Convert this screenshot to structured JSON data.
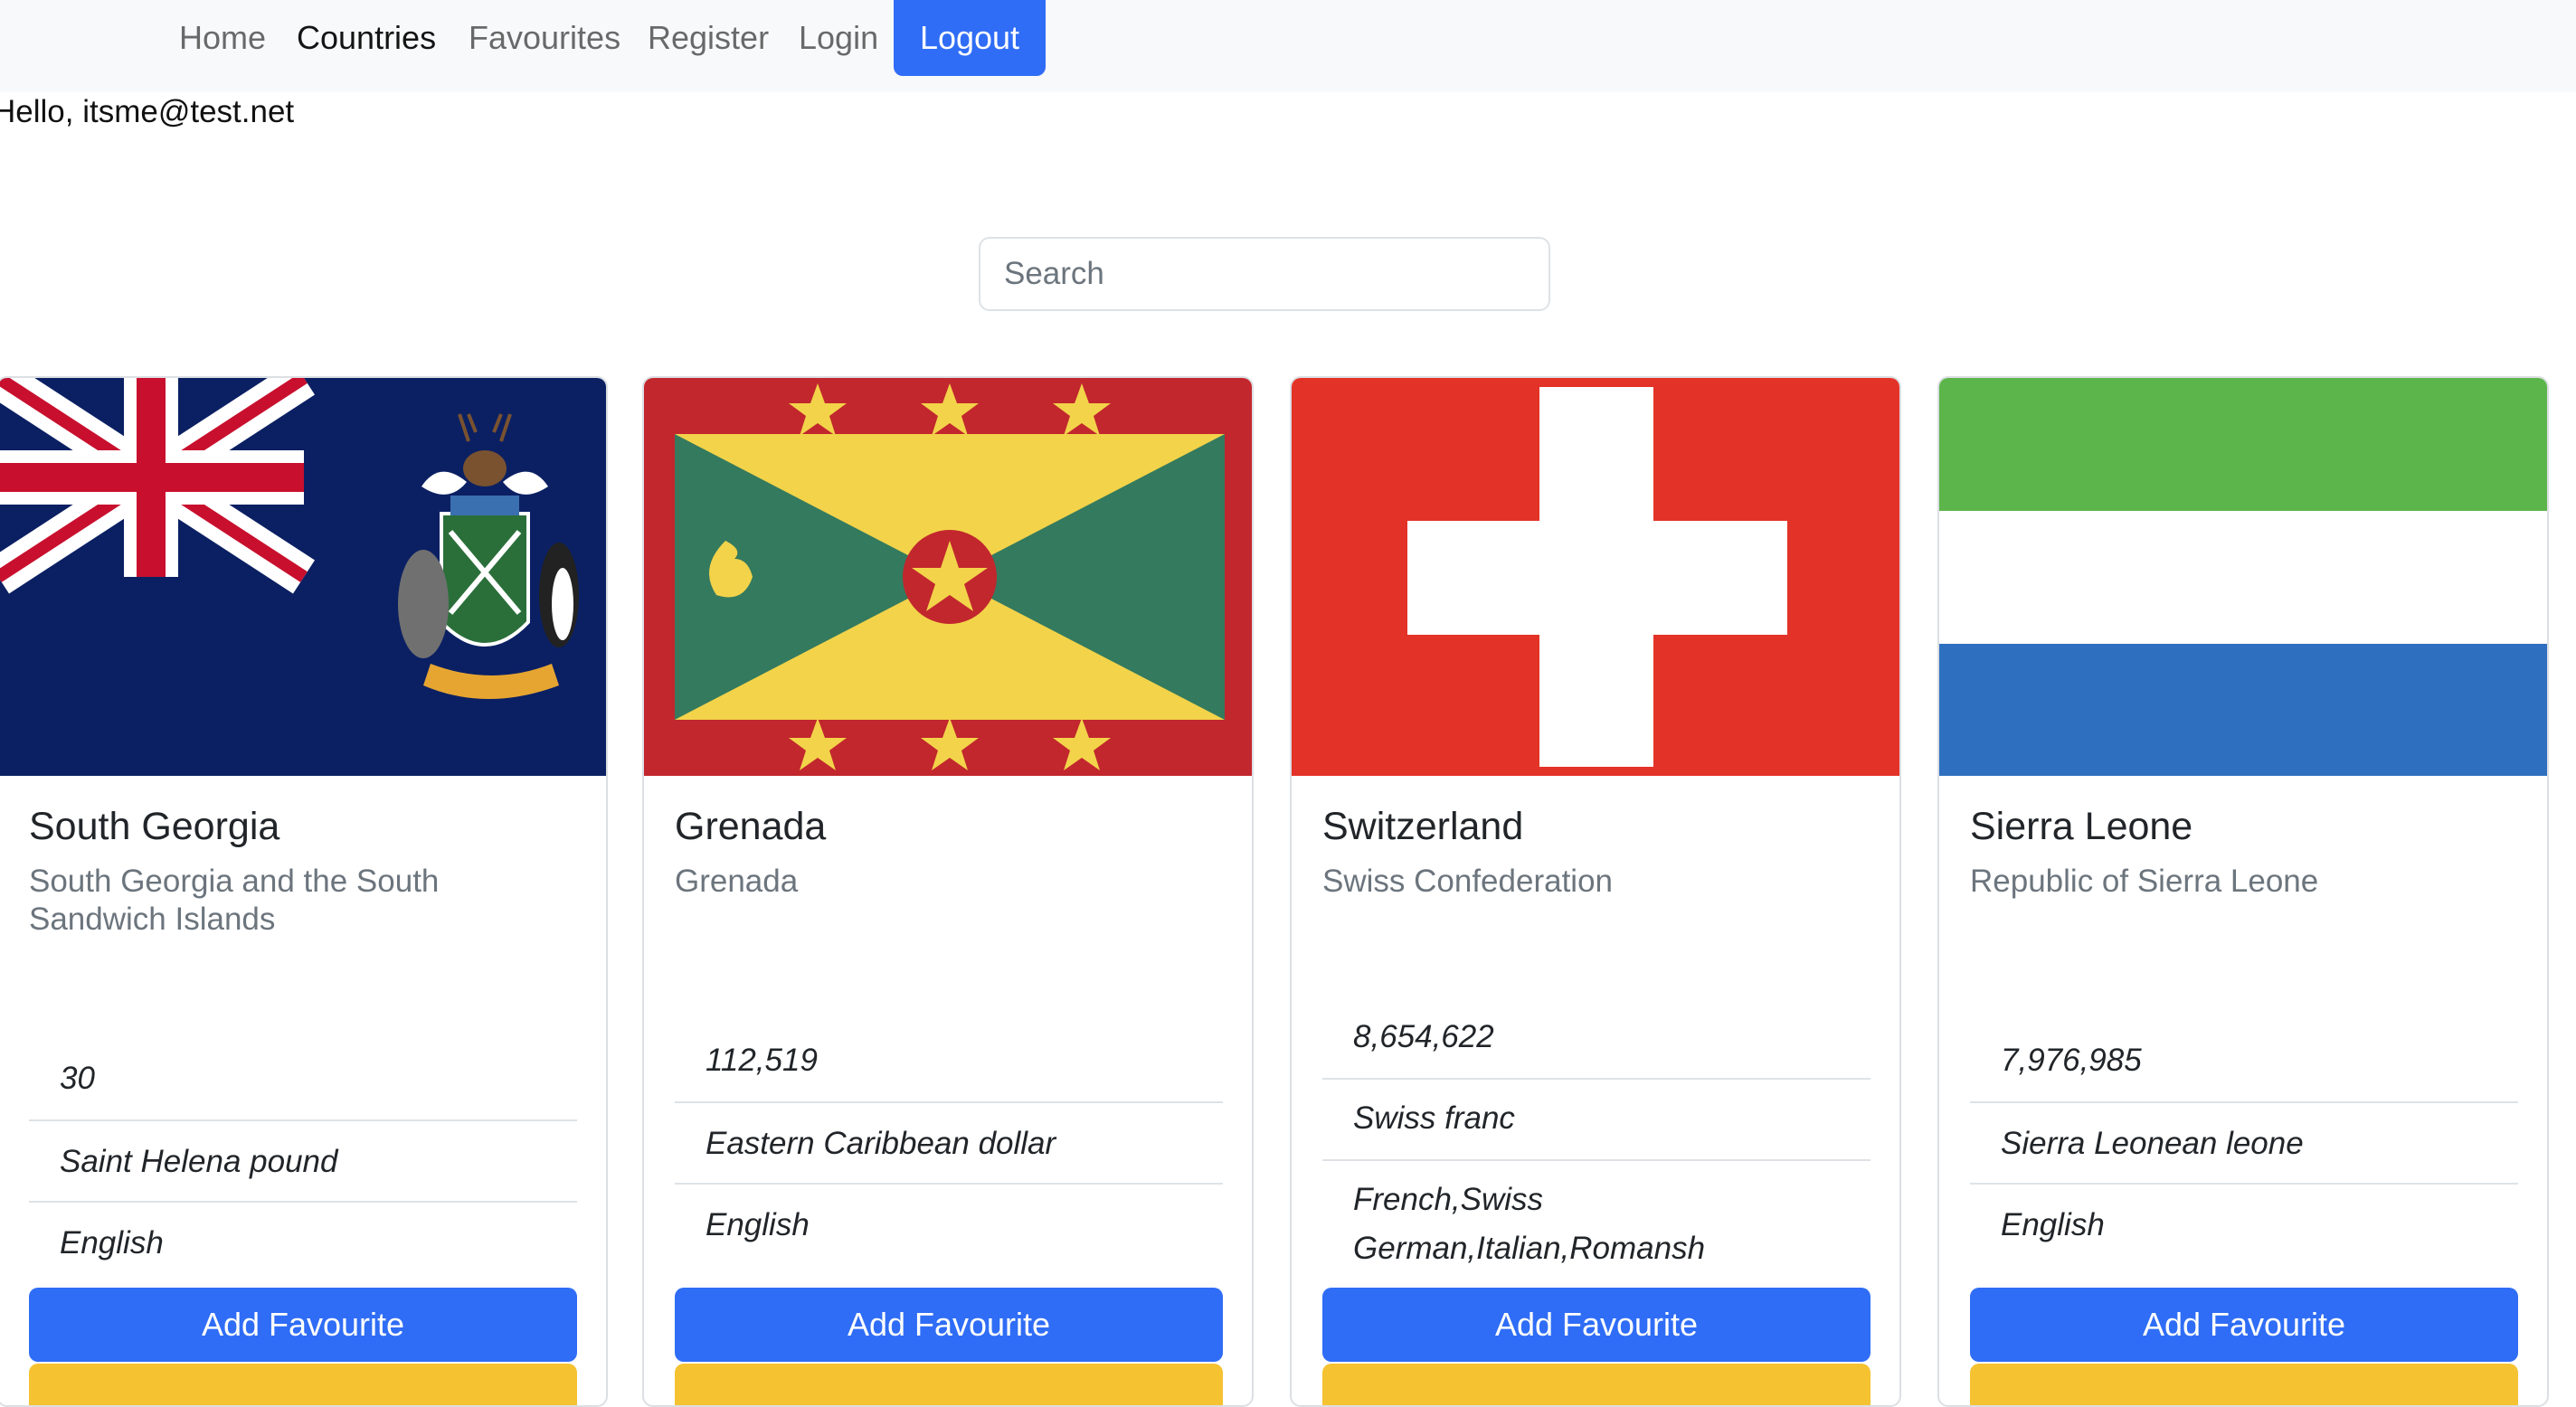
{
  "nav": {
    "home": "Home",
    "countries": "Countries",
    "favourites": "Favourites",
    "register": "Register",
    "login": "Login",
    "logout": "Logout"
  },
  "greeting": "Hello, itsme@test.net",
  "search": {
    "placeholder": "Search",
    "value": ""
  },
  "colors": {
    "primary": "#2f6df6",
    "warning": "#f5c232",
    "navbar_bg": "#f8f9fa"
  },
  "cards": [
    {
      "name": "South Georgia",
      "official_name": "South Georgia and the South Sandwich Islands",
      "population": "30",
      "currency": "Saint Helena pound",
      "languages": "English",
      "flag_icon": "south-georgia-flag-icon",
      "button_label": "Add Favourite"
    },
    {
      "name": "Grenada",
      "official_name": "Grenada",
      "population": "112,519",
      "currency": "Eastern Caribbean dollar",
      "languages": "English",
      "flag_icon": "grenada-flag-icon",
      "button_label": "Add Favourite"
    },
    {
      "name": "Switzerland",
      "official_name": "Swiss Confederation",
      "population": "8,654,622",
      "currency": "Swiss franc",
      "languages": "French,Swiss German,Italian,Romansh",
      "flag_icon": "switzerland-flag-icon",
      "button_label": "Add Favourite"
    },
    {
      "name": "Sierra Leone",
      "official_name": "Republic of Sierra Leone",
      "population": "7,976,985",
      "currency": "Sierra Leonean leone",
      "languages": "English",
      "flag_icon": "sierra-leone-flag-icon",
      "button_label": "Add Favourite"
    }
  ]
}
